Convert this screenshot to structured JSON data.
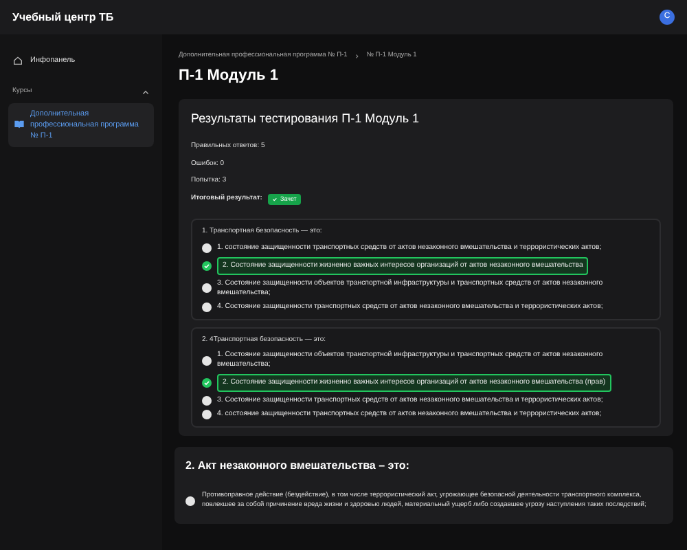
{
  "header": {
    "title": "Учебный центр ТБ",
    "avatar": "С"
  },
  "sidebar": {
    "items": [
      {
        "label": "Инфопанель",
        "selected": false
      }
    ],
    "section": {
      "label": "Курсы",
      "expanded": true,
      "items": [
        {
          "label": "Дополнительная профессиональная программа № П-1",
          "selected": true
        }
      ]
    }
  },
  "breadcrumb": [
    "Дополнительная профессиональная программа № П-1",
    "№ П-1 Модуль 1"
  ],
  "page_title": "П-1 Модуль 1",
  "results": {
    "title": "Результаты тестирования П-1 Модуль 1",
    "stats": [
      "Правильных ответов: 5",
      "Ошибок: 0",
      "Попытка: 3"
    ],
    "final_label": "Итоговый результат:",
    "final_badge": "Зачет",
    "passed": true,
    "questions": [
      {
        "text": "1. Транспортная безопасность — это:",
        "options": [
          {
            "text": "1. состояние защищенности транспортных средств от актов незаконного вмешательства и террористических актов;",
            "selected": false
          },
          {
            "text": "2. Состояние защищенности жизненно важных интересов организаций от актов незаконного вмешательства",
            "selected": true
          },
          {
            "text": "3. Состояние защищенности объектов транспортной инфраструктуры и транспортных средств от актов незаконного вмешательства;",
            "selected": false
          },
          {
            "text": "4. Состояние защищенности транспортных средств от актов незаконного вмешательства и террористических актов;",
            "selected": false
          }
        ]
      },
      {
        "text": "2. 4Транспортная безопасность — это:",
        "options": [
          {
            "text": "1. Состояние защищенности объектов транспортной инфраструктуры и транспортных средств от актов незаконного вмешательства;",
            "selected": false
          },
          {
            "text": "2. Состояние защищенности жизненно важных интересов организаций от актов незаконного вмешательства (прав)",
            "selected": true
          },
          {
            "text": "3. Состояние защищенности транспортных средств от актов незаконного вмешательства и террористических актов;",
            "selected": false
          },
          {
            "text": "4. состояние защищенности транспортных средств от актов незаконного вмешательства и террористических актов;",
            "selected": false
          }
        ]
      }
    ]
  },
  "question": {
    "title": "2. Акт незаконного вмешательства – это:",
    "options": [
      {
        "text": "Противоправное действие (бездействие), в том числе террористический акт, угрожающее безопасной деятельности транспортного комплекса, повлекшее за собой причинение вреда жизни и здоровью людей, материальный ущерб либо создавшее угрозу наступления таких последствий;",
        "selected": false
      }
    ]
  }
}
